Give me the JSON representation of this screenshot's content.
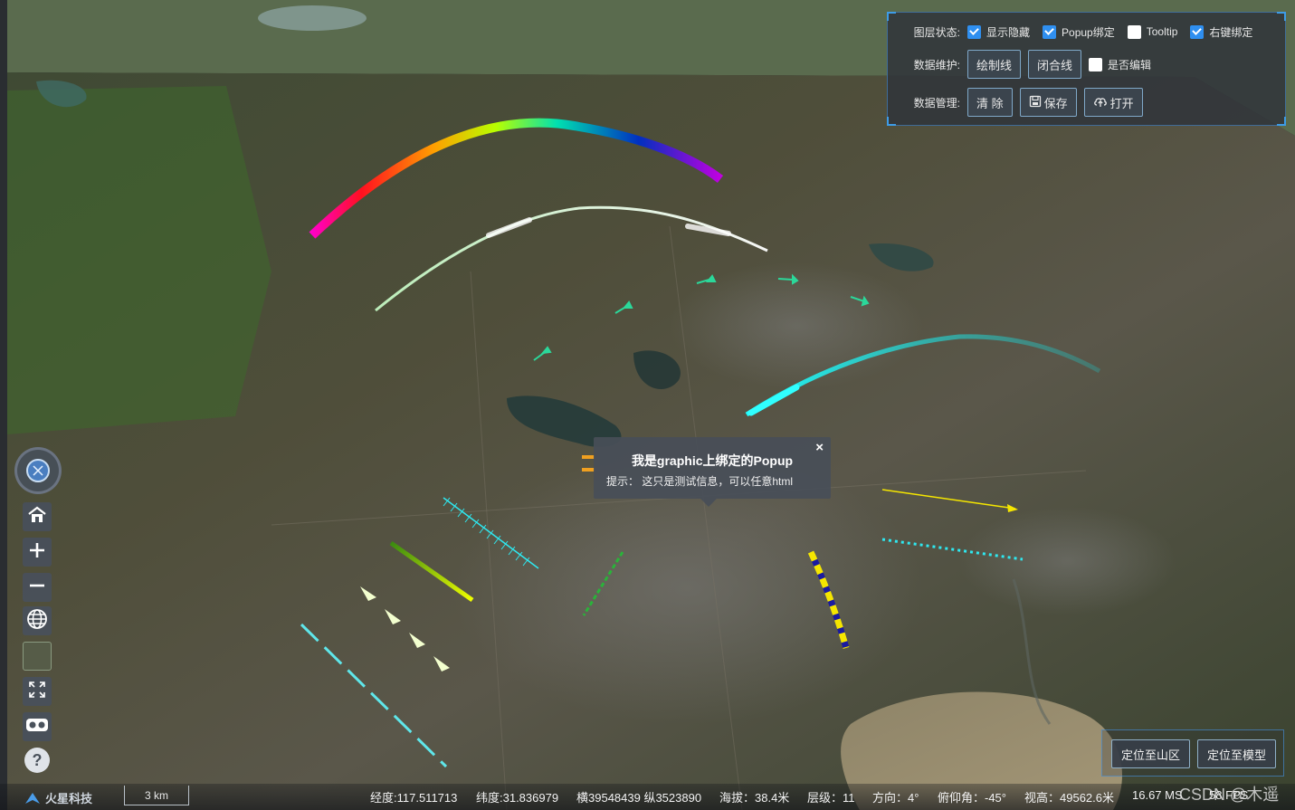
{
  "layer_panel": {
    "row1_label": "图层状态:",
    "show_hide": {
      "label": "显示隐藏",
      "checked": true
    },
    "popup_bind": {
      "label": "Popup绑定",
      "checked": true
    },
    "tooltip": {
      "label": "Tooltip",
      "checked": false
    },
    "rightclick_bind": {
      "label": "右键绑定",
      "checked": true
    },
    "row2_label": "数据维护:",
    "draw_line_label": "绘制线",
    "close_line_label": "闭合线",
    "editable": {
      "label": "是否编辑",
      "checked": false
    },
    "row3_label": "数据管理:",
    "clear_label": "清 除",
    "save_label": "保存",
    "open_label": "打开"
  },
  "popup": {
    "title": "我是graphic上绑定的Popup",
    "body": "提示： 这只是测试信息，可以任意html",
    "close": "×"
  },
  "locate": {
    "mountain_label": "定位至山区",
    "model_label": "定位至模型"
  },
  "toolbar": {
    "icons": [
      "compass-icon",
      "home-icon",
      "zoom-in-icon",
      "zoom-out-icon",
      "globe-icon",
      "basemap-icon",
      "fullscreen-icon",
      "vr-icon",
      "help-icon"
    ]
  },
  "status": {
    "logo": "火星科技",
    "scale": "3 km",
    "lon": "经度:117.511713",
    "lat": "纬度:31.836979",
    "xy": "横39548439 纵3523890",
    "alt": "海拔：38.4米",
    "level": "层级：11",
    "heading": "方向：4°",
    "pitch": "俯仰角：-45°",
    "view_height": "视高：49562.6米",
    "ms": "16.67 MS",
    "fps": "58 FPS"
  },
  "watermark": "CSDN @木遥",
  "colors": {
    "accent": "#2f8ff0",
    "panel_border": "#3d9ce8",
    "cyan_line": "#2ee8f0",
    "yellow_line": "#f5e600"
  }
}
